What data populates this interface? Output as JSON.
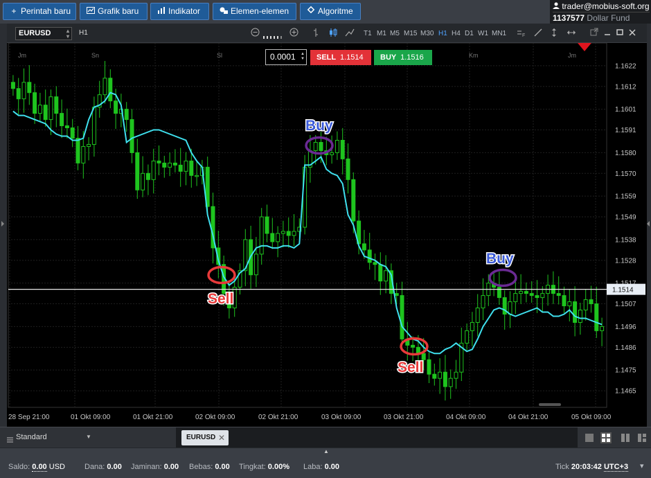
{
  "toolbar": {
    "buttons": [
      {
        "icon": "plus-icon",
        "label": "Perintah baru"
      },
      {
        "icon": "chart-line-icon",
        "label": "Grafik baru"
      },
      {
        "icon": "bars-icon",
        "label": "Indikator"
      },
      {
        "icon": "shapes-icon",
        "label": "Elemen-elemen"
      },
      {
        "icon": "diamond-icon",
        "label": "Algoritme"
      }
    ]
  },
  "account": {
    "user": "trader@mobius-soft.org",
    "number": "1137577",
    "fund": "Dollar Fund"
  },
  "chart_toolbar": {
    "symbol": "EURUSD",
    "timeframe_label": "H1",
    "timeframes": [
      "T1",
      "M1",
      "M5",
      "M15",
      "M30",
      "H1",
      "H4",
      "D1",
      "W1",
      "MN1"
    ],
    "active_timeframe": "H1"
  },
  "trade": {
    "lot": "0.0001",
    "sell_label": "SELL",
    "sell_price": "1.1514",
    "buy_label": "BUY",
    "buy_price": "1.1516"
  },
  "annotations": {
    "buy": "Buy",
    "sell": "Sell"
  },
  "bottom": {
    "layout_label": "Standard",
    "tab": "EURUSD"
  },
  "status": {
    "saldo_label": "Saldo:",
    "saldo_value": "0.00",
    "saldo_currency": "USD",
    "dana_label": "Dana:",
    "dana_value": "0.00",
    "jaminan_label": "Jaminan:",
    "jaminan_value": "0.00",
    "bebas_label": "Bebas:",
    "bebas_value": "0.00",
    "tingkat_label": "Tingkat:",
    "tingkat_value": "0.00%",
    "laba_label": "Laba:",
    "laba_value": "0.00",
    "tick_label": "Tick",
    "time": "20:03:42",
    "timezone": "UTC+3"
  },
  "chart_data": {
    "type": "candlestick",
    "current_price": "1.1514",
    "y_ticks": [
      "1.1622",
      "1.1612",
      "1.1601",
      "1.1591",
      "1.1580",
      "1.1570",
      "1.1559",
      "1.1549",
      "1.1538",
      "1.1528",
      "1.1517",
      "1.1507",
      "1.1496",
      "1.1486",
      "1.1475",
      "1.1465"
    ],
    "x_ticks": [
      "28 Sep 21:00",
      "01 Okt 09:00",
      "01 Okt 21:00",
      "02 Okt 09:00",
      "02 Okt 21:00",
      "03 Okt 09:00",
      "03 Okt 21:00",
      "04 Okt 09:00",
      "04 Okt 21:00",
      "05 Okt 09:00"
    ],
    "day_labels": [
      "Jm",
      "Sn",
      "Sl",
      "Rb",
      "Km",
      "Jm"
    ],
    "ylim": [
      1.1459,
      1.1631
    ],
    "ma_color": "#3fe0ee",
    "candle_color": "#1ec41e",
    "closes": [
      1.1611,
      1.1606,
      1.1614,
      1.1609,
      1.1599,
      1.1603,
      1.1596,
      1.1607,
      1.1599,
      1.1593,
      1.1592,
      1.1587,
      1.1575,
      1.1583,
      1.1584,
      1.1602,
      1.1608,
      1.1616,
      1.1605,
      1.1599,
      1.1601,
      1.1596,
      1.158,
      1.1562,
      1.157,
      1.1567,
      1.1576,
      1.1575,
      1.1573,
      1.1575,
      1.1574,
      1.1571,
      1.1576,
      1.1569,
      1.1569,
      1.1573,
      1.1554,
      1.1534,
      1.1526,
      1.1512,
      1.1505,
      1.1515,
      1.1523,
      1.1538,
      1.1521,
      1.1531,
      1.1549,
      1.1541,
      1.1537,
      1.1541,
      1.1542,
      1.154,
      1.1542,
      1.1544,
      1.1573,
      1.1581,
      1.1585,
      1.1581,
      1.1579,
      1.158,
      1.1586,
      1.1577,
      1.1567,
      1.1547,
      1.1536,
      1.1533,
      1.1527,
      1.1526,
      1.1518,
      1.1523,
      1.1512,
      1.1511,
      1.149,
      1.1487,
      1.1486,
      1.1483,
      1.148,
      1.1473,
      1.1471,
      1.1474,
      1.1467,
      1.1471,
      1.1474,
      1.1488,
      1.1494,
      1.1498,
      1.1505,
      1.1511,
      1.1517,
      1.1515,
      1.151,
      1.1502,
      1.1508,
      1.1512,
      1.1513,
      1.1512,
      1.1511,
      1.151,
      1.1512,
      1.1516,
      1.1512,
      1.1511,
      1.1506,
      1.1508,
      1.1498,
      1.1504,
      1.1509,
      1.1507,
      1.1494,
      1.1496
    ],
    "ma": [
      1.16,
      1.1598,
      1.1598,
      1.1597,
      1.1596,
      1.1595,
      1.1594,
      1.1591,
      1.1589,
      1.1588,
      1.1588,
      1.1586,
      1.1586,
      1.1587,
      1.1596,
      1.1602,
      1.1603,
      1.1605,
      1.1609,
      1.1608,
      1.1603,
      1.1585,
      1.1587,
      1.1588,
      1.1589,
      1.159,
      1.1591,
      1.1591,
      1.159,
      1.1589,
      1.1588,
      1.1587,
      1.1586,
      1.158,
      1.1576,
      1.1573,
      1.155,
      1.154,
      1.1528,
      1.152,
      1.1516,
      1.1518,
      1.1522,
      1.1524,
      1.153,
      1.1534,
      1.1535,
      1.1535,
      1.1534,
      1.1534,
      1.1535,
      1.1535,
      1.1534,
      1.1536,
      1.1574,
      1.1574,
      1.1576,
      1.1578,
      1.1572,
      1.157,
      1.1569,
      1.1565,
      1.155,
      1.1545,
      1.1535,
      1.153,
      1.1529,
      1.1528,
      1.1526,
      1.1525,
      1.1521,
      1.1505,
      1.1496,
      1.1493,
      1.149,
      1.1489,
      1.1486,
      1.1484,
      1.1483,
      1.1483,
      1.1485,
      1.1486,
      1.1488,
      1.1486,
      1.1484,
      1.1485,
      1.149,
      1.1496,
      1.15,
      1.1504,
      1.1505,
      1.1504,
      1.1502,
      1.1501,
      1.1502,
      1.1503,
      1.1504,
      1.1505,
      1.1503,
      1.1503,
      1.1501,
      1.1501,
      1.1502,
      1.1504,
      1.1501,
      1.15,
      1.15,
      1.1499,
      1.1498,
      1.1497
    ]
  }
}
